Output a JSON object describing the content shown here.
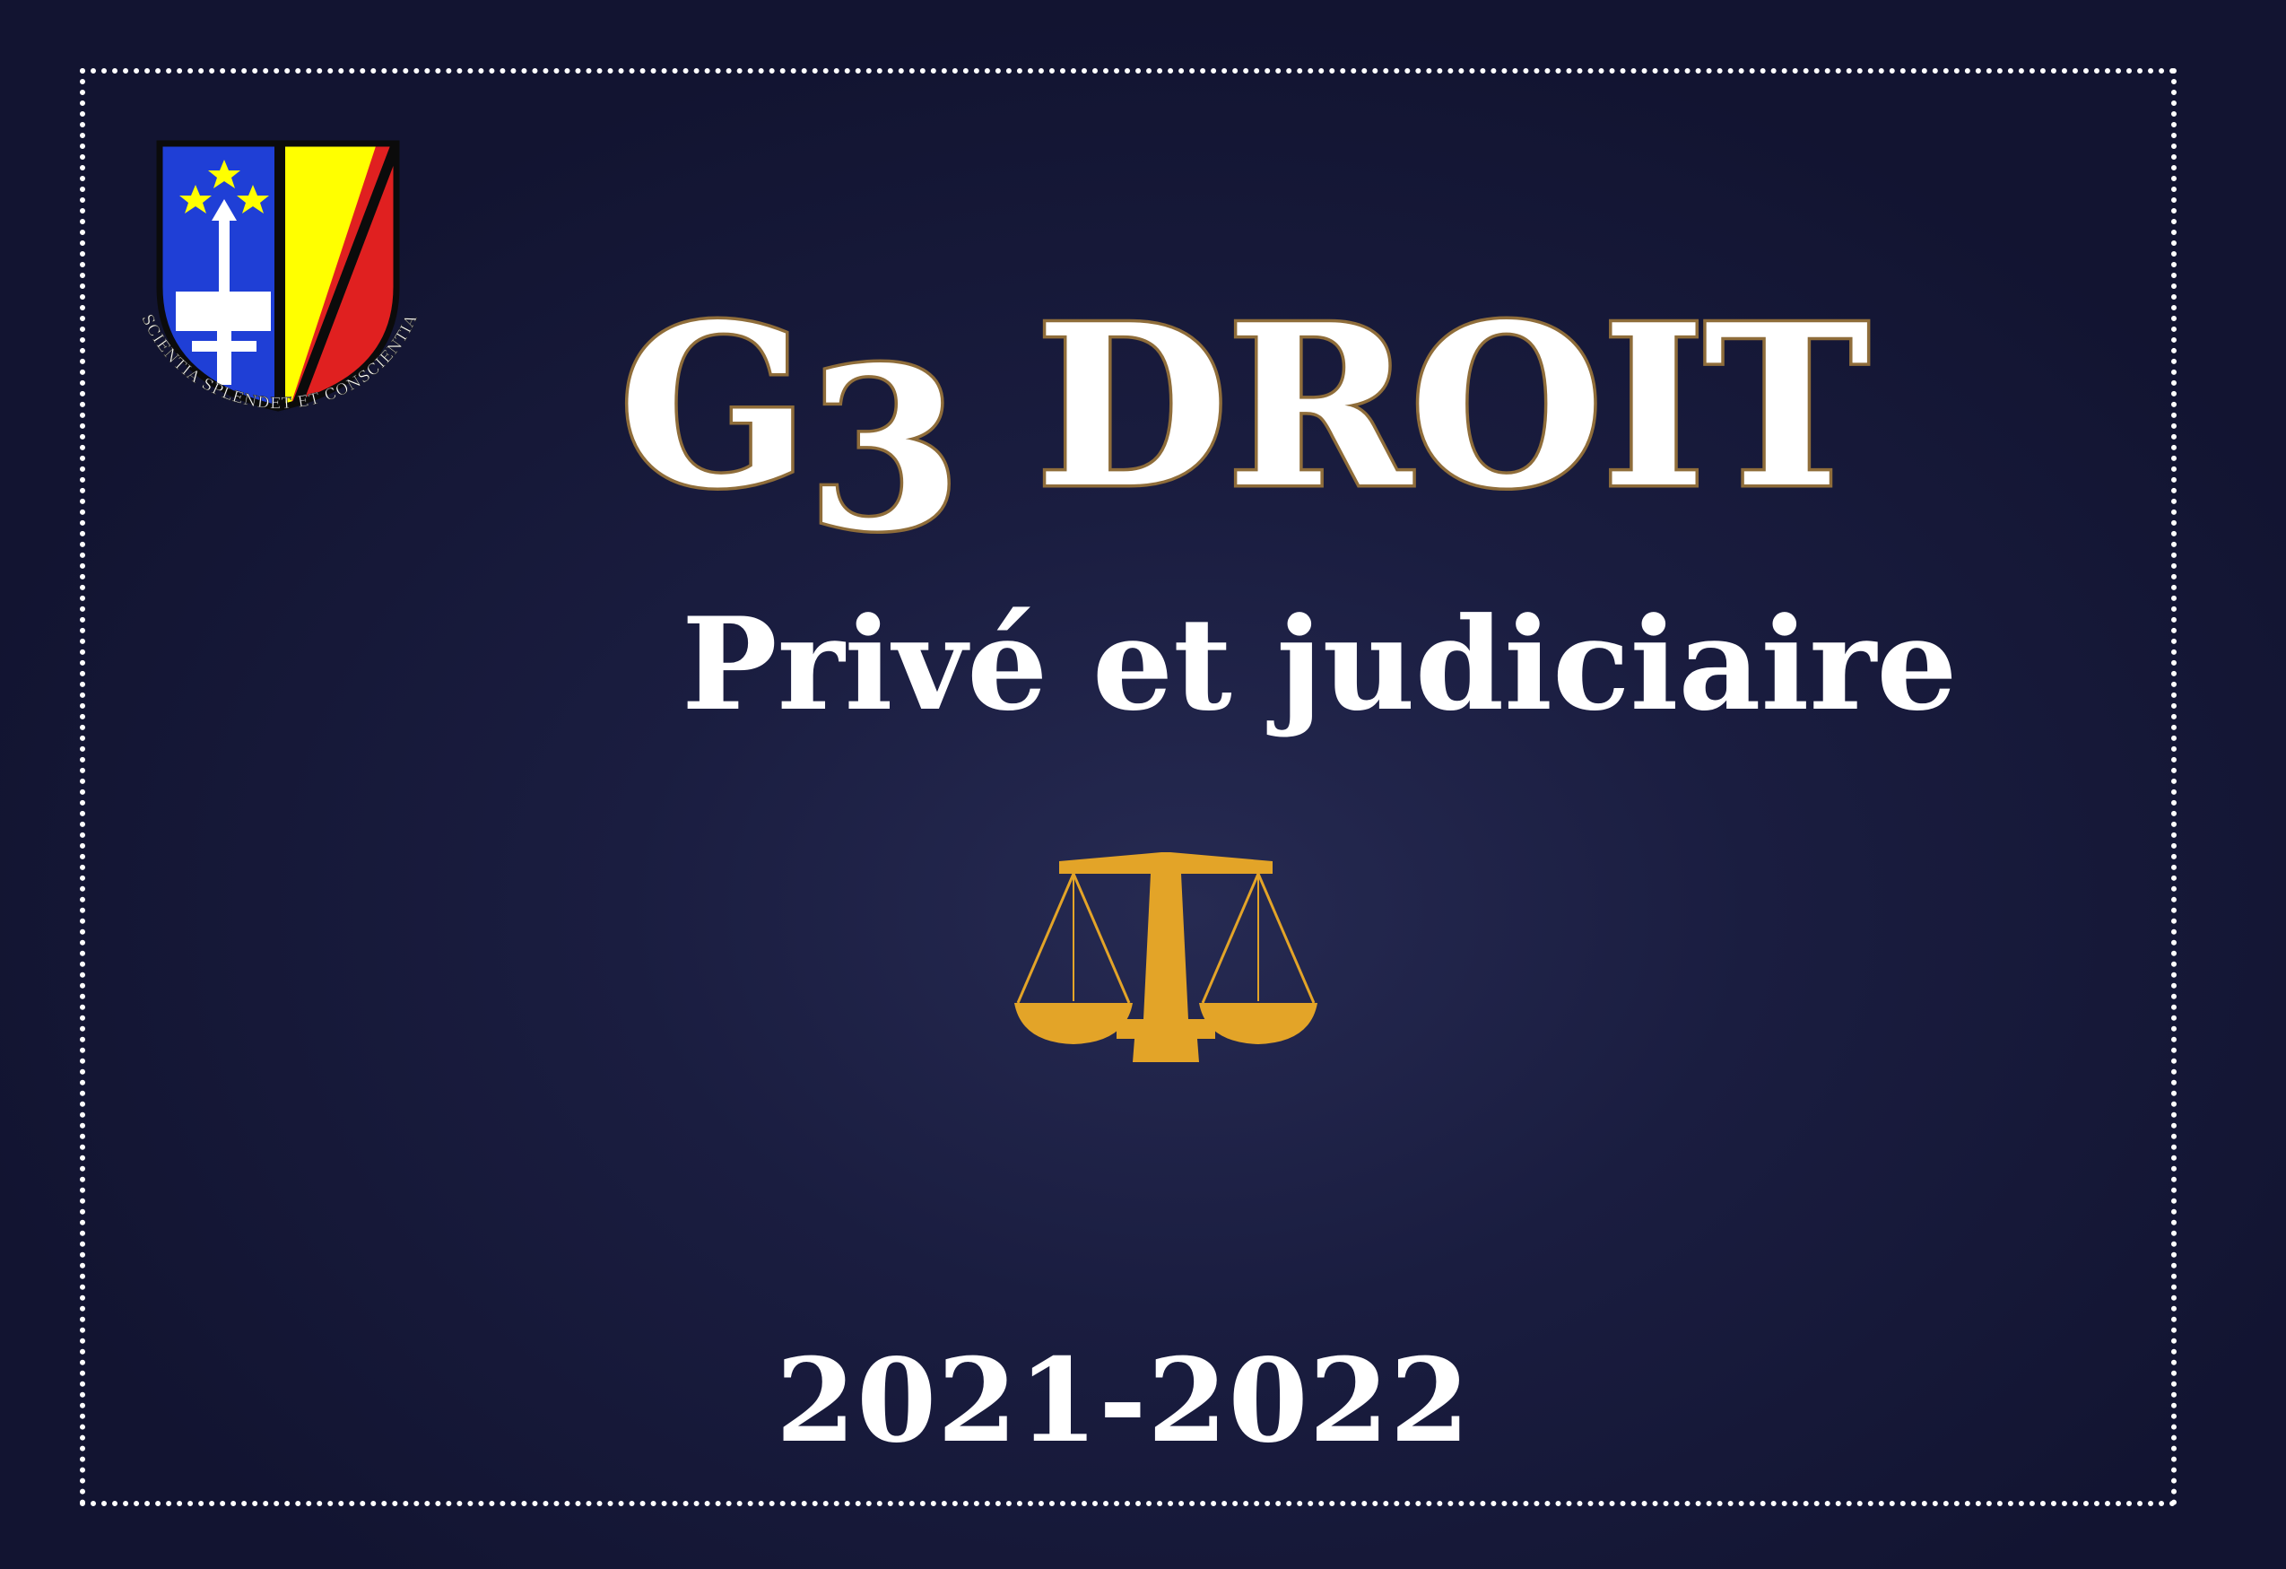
{
  "cover": {
    "title_main": "G3 DROIT",
    "title_part1": "G",
    "title_part2": "3",
    "title_part3": " DROIT",
    "subtitle": "Privé et judiciaire",
    "academic_year": "2021-2022",
    "crest": {
      "motto": "SCIENTIA SPLENDET ET CONSCIENTIA",
      "left_field_color": "#1f3fd6",
      "right_field_color": "#ffff00",
      "band_color": "#e02020"
    },
    "icon": "scales-of-justice-icon",
    "accent_color": "#e3a428",
    "background_color": "#1a1d40"
  }
}
